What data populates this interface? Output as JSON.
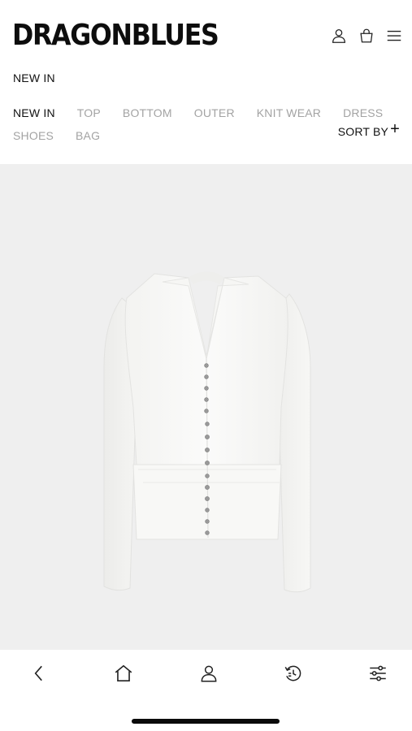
{
  "header": {
    "logo": "DRAGONBLUES",
    "icons": [
      "user-icon",
      "shopping-bag-icon",
      "menu-icon"
    ]
  },
  "breadcrumb": "NEW IN",
  "categories": {
    "row1": [
      "NEW IN",
      "TOP",
      "BOTTOM",
      "OUTER",
      "KNIT WEAR",
      "DRESS"
    ],
    "row2": [
      "SHOES",
      "BAG"
    ],
    "active": "NEW IN",
    "sort_label": "SORT BY",
    "sort_icon": "+"
  },
  "product": {
    "image": "white-v-neck-cardigan",
    "background": "#efefef"
  },
  "bottom_nav": [
    "back-icon",
    "home-icon",
    "account-icon",
    "history-icon",
    "filter-icon"
  ],
  "colors": {
    "text": "#111111",
    "inactive": "#a3a3a3",
    "image_bg": "#efefef"
  }
}
